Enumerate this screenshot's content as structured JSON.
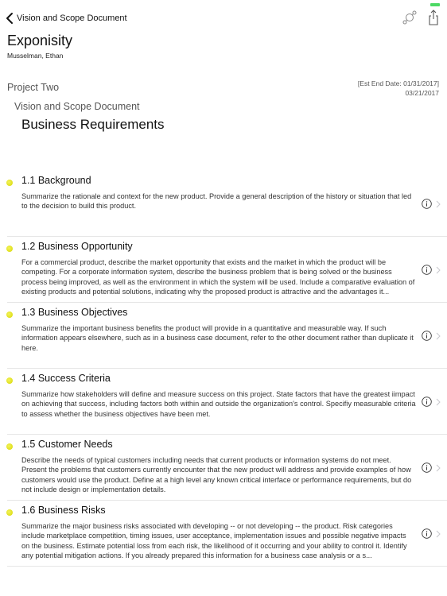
{
  "nav": {
    "back_label": "Vision and Scope Document",
    "back_icon": "chevron-left-icon",
    "tools": [
      {
        "name": "link-icon"
      },
      {
        "name": "share-icon"
      }
    ],
    "status_indicator_color": "#4cd964"
  },
  "header": {
    "app_title": "Exponisity",
    "user": "Musselman, Ethan",
    "project": "Project Two",
    "est_end_date": "[Est End Date: 01/31/2017]",
    "date": "03/21/2017",
    "document": "Vision and Scope Document",
    "section": "Business Requirements"
  },
  "accent": {
    "bullet_color": "#e0e000"
  },
  "items": [
    {
      "title": "1.1 Background",
      "desc": "Summarize the rationale and context for the new product. Provide a general description of the history or situation that led to the decision to build this product."
    },
    {
      "title": "1.2 Business Opportunity",
      "desc": "For a commercial product, describe the market opportunity that exists and the market in which the product will be competing. For a corporate information system, describe the business problem that is being solved or the business process being improved, as well as the environment in which the system will be used. Include a comparative evaluation of existing products and potential solutions, indicating why the proposed product is attractive and the advantages it..."
    },
    {
      "title": "1.3 Business Objectives",
      "desc": "Summarize the important business benefits the product will provide in a quantitative and measurable way. If such information appears elsewhere, such as in a business case document, refer to the other document rather than duplicate it here."
    },
    {
      "title": "1.4 Success Criteria",
      "desc": "Summarize how stakeholders will define and measure success on this project. State factors that have the greatest iimpact on achieving that success, including factors both within and outside the organization's control. Specifiy measurable criteria to assess whether the business objectives have been met."
    },
    {
      "title": "1.5 Customer Needs",
      "desc": "Describe the needs of typical customers including needs that current products or information systems do not meet. Present the problems that customers currently encounter that the new product will address and provide examples of how customers would use the product. Define at a high level any known critical interface or performance requirements, but do not include design or implementation details."
    },
    {
      "title": "1.6 Business Risks",
      "desc": "Summarize the major business risks associated with developing -- or not developing -- the product. Risk categories include marketplace competition, timing issues, user acceptance, implementation issues and possible negative impacts on the business. Estimate potential loss from each risk, the likelihood of it occurring and your ability to control it. Identify any potential mitigation actions. If you already prepared this information for a business case analysis or a s..."
    }
  ]
}
